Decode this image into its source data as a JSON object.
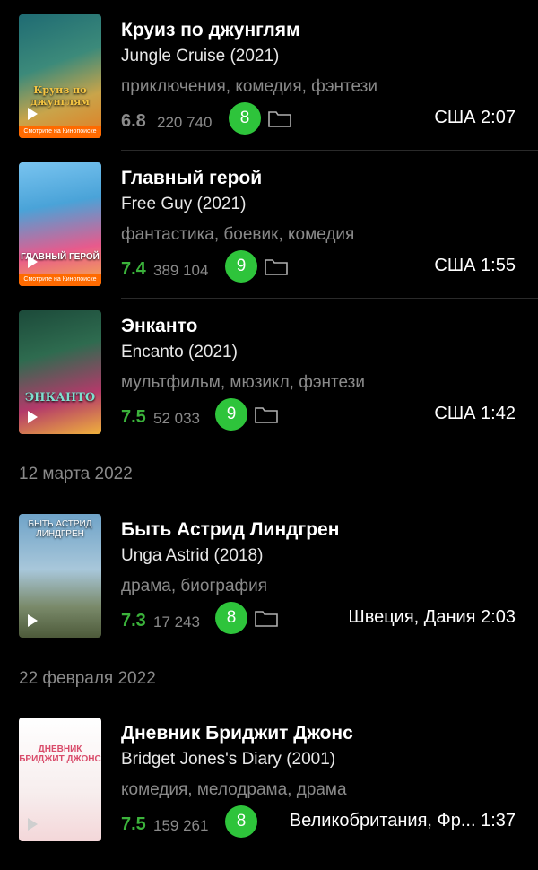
{
  "dates": [
    "12 марта 2022",
    "22 февраля 2022"
  ],
  "films": [
    {
      "title": "Круиз по джунглям",
      "original": "Jungle Cruise (2021)",
      "genres": "приключения, комедия, фэнтези",
      "rating": "6.8",
      "rating_color": "#8a8a8a",
      "votes": "220 740",
      "my_vote": "8",
      "country_time": "США 2:07",
      "poster": {
        "text": "Круиз по джунглям",
        "caption": "Смотрите на Кинопоиске",
        "colors": [
          "#1f6b73",
          "#c9a44a",
          "#e37c21"
        ]
      }
    },
    {
      "title": "Главный герой",
      "original": "Free Guy (2021)",
      "genres": "фантастика, боевик, комедия",
      "rating": "7.4",
      "rating_color": "#3bb33b",
      "votes": "389 104",
      "my_vote": "9",
      "country_time": "США 1:55",
      "poster": {
        "text": "ГЛАВНЫЙ ГЕРОЙ",
        "caption": "Смотрите на Кинопоиске",
        "colors": [
          "#79c4f0",
          "#e85a8c",
          "#f5b04c"
        ]
      }
    },
    {
      "title": "Энканто",
      "original": "Encanto (2021)",
      "genres": "мультфильм, мюзикл, фэнтези",
      "rating": "7.5",
      "rating_color": "#3bb33b",
      "votes": "52 033",
      "my_vote": "9",
      "country_time": "США 1:42",
      "poster": {
        "text": "ЭНКАНТО",
        "caption": "",
        "colors": [
          "#1c4a3a",
          "#b33a6a",
          "#f0b23c"
        ]
      }
    },
    {
      "title": "Быть Астрид Линдгрен",
      "original": "Unga Astrid (2018)",
      "genres": "драма, биография",
      "rating": "7.3",
      "rating_color": "#3bb33b",
      "votes": "17 243",
      "my_vote": "8",
      "country_time": "Швеция, Дания 2:03",
      "poster": {
        "text": "БЫТЬ АСТРИД ЛИНДГРЕН",
        "caption": "",
        "colors": [
          "#6fa3c8",
          "#a8c7da",
          "#4d5a3a"
        ]
      }
    },
    {
      "title": "Дневник Бриджит Джонс",
      "original": "Bridget Jones's Diary (2001)",
      "genres": "комедия, мелодрама, драма",
      "rating": "7.5",
      "rating_color": "#3bb33b",
      "votes": "159 261",
      "my_vote": "8",
      "country_time": "Великобритания, Фр... 1:37",
      "poster": {
        "text": "ДНЕВНИК БРИДЖИТ ДЖОНС",
        "caption": "",
        "colors": [
          "#ffffff",
          "#f4d7d9",
          "#d94b6a"
        ]
      }
    }
  ],
  "icons": {
    "folder": "folder-icon",
    "play": "play-icon"
  }
}
